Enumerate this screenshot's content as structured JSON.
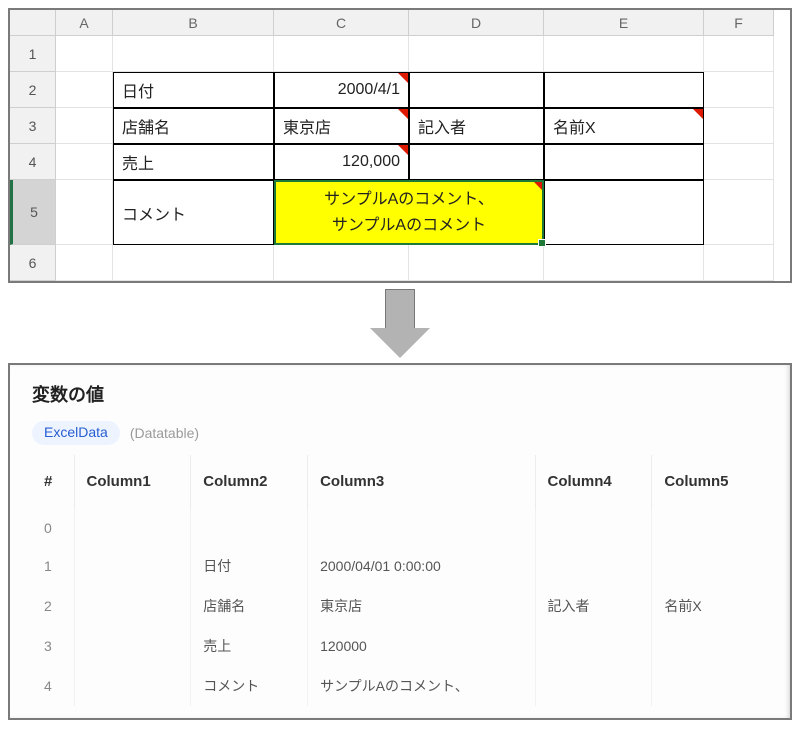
{
  "excel": {
    "col_headers": [
      "A",
      "B",
      "C",
      "D",
      "E",
      "F"
    ],
    "row_headers": [
      "1",
      "2",
      "3",
      "4",
      "5",
      "6"
    ],
    "cells": {
      "r2B": "日付",
      "r2C": "2000/4/1",
      "r3B": "店舗名",
      "r3C": "東京店",
      "r3D": "記入者",
      "r3E": "名前X",
      "r4B": "売上",
      "r4C": "120,000",
      "r5B": "コメント",
      "r5CD": "サンプルAのコメント、\nサンプルAのコメント"
    }
  },
  "varPanel": {
    "title": "変数の値",
    "badge": "ExcelData",
    "type": "(Datatable)",
    "columns": [
      "#",
      "Column1",
      "Column2",
      "Column3",
      "Column4",
      "Column5"
    ],
    "rows": [
      {
        "idx": "0",
        "c1": "",
        "c2": "",
        "c3": "",
        "c4": "",
        "c5": ""
      },
      {
        "idx": "1",
        "c1": "",
        "c2": "日付",
        "c3": "2000/04/01 0:00:00",
        "c4": "",
        "c5": ""
      },
      {
        "idx": "2",
        "c1": "",
        "c2": "店舗名",
        "c3": "東京店",
        "c4": "記入者",
        "c5": "名前X"
      },
      {
        "idx": "3",
        "c1": "",
        "c2": "売上",
        "c3": "120000",
        "c4": "",
        "c5": ""
      },
      {
        "idx": "4",
        "c1": "",
        "c2": "コメント",
        "c3": "サンプルAのコメント、",
        "c4": "",
        "c5": ""
      }
    ]
  }
}
